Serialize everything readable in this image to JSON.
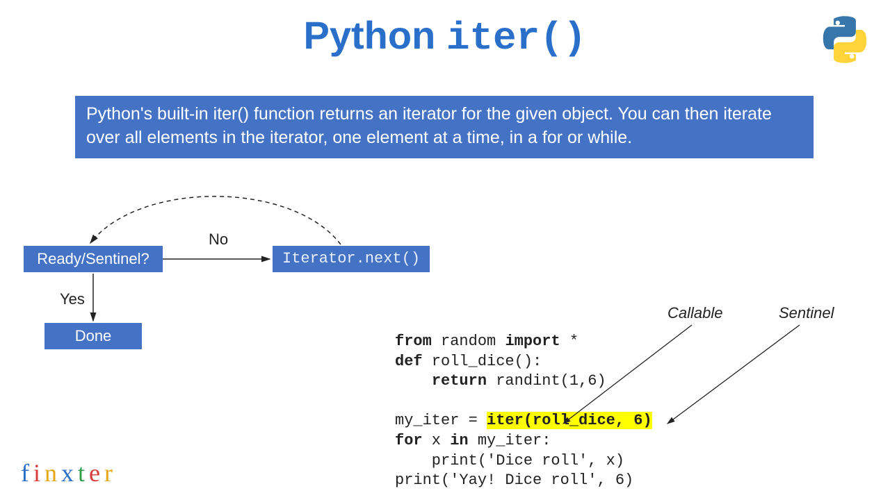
{
  "title": {
    "prefix": "Python ",
    "mono": "iter()"
  },
  "description": "Python's built-in iter() function returns an iterator for the given object. You can then iterate over all elements in the iterator, one element at a time, in a for or while.",
  "flow": {
    "sentinel": "Ready/Sentinel?",
    "next": "Iterator.next()",
    "done": "Done",
    "no": "No",
    "yes": "Yes"
  },
  "labels": {
    "callable": "Callable",
    "sentinel": "Sentinel"
  },
  "code": {
    "l1a": "from",
    "l1b": " random ",
    "l1c": "import",
    "l1d": " *",
    "l2a": "def",
    "l2b": " roll_dice():",
    "l3a": "    ",
    "l3b": "return",
    "l3c": " randint(1,6)",
    "l4": "",
    "l5a": "my_iter = ",
    "l5b": "iter(roll_dice, 6)",
    "l6a": "for",
    "l6b": " x ",
    "l6c": "in",
    "l6d": " my_iter:",
    "l7": "    print('Dice roll', x)",
    "l8": "print('Yay! Dice roll', 6)"
  },
  "brand": {
    "c1": "f",
    "c2": "i",
    "c3": "n",
    "c4": "x",
    "c5": "t",
    "c6": "e",
    "c7": "r"
  }
}
